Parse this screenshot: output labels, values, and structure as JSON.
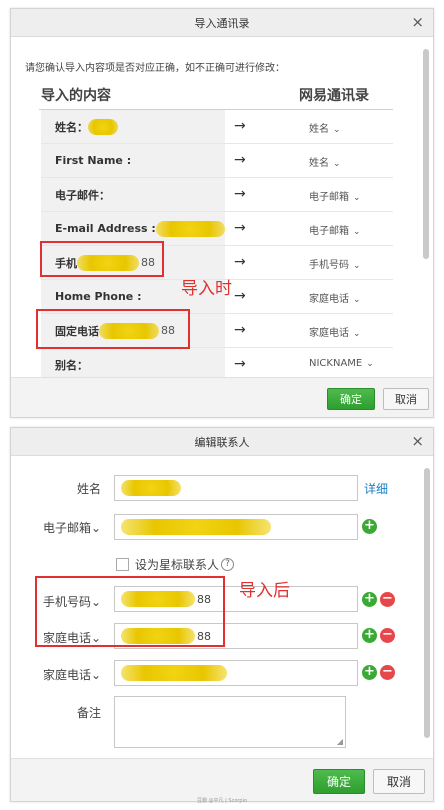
{
  "import_dialog": {
    "title": "导入通讯录",
    "close_glyph": "×",
    "intro": "请您确认导入内容项是否对应正确，如不正确可进行修改：",
    "col_source": "导入的内容",
    "col_target": "网易通讯录",
    "arrow_glyph": "→",
    "chevron_glyph": "⌄",
    "rows": [
      {
        "source": "姓名：",
        "value_suffix": "",
        "target": "姓名"
      },
      {
        "source": "First Name :",
        "value_suffix": "",
        "target": "姓名"
      },
      {
        "source": "电子邮件：",
        "value_suffix": "",
        "target": "电子邮箱"
      },
      {
        "source": "E-mail Address :",
        "value_suffix": "",
        "target": "电子邮箱"
      },
      {
        "source": "手机",
        "value_suffix": "88",
        "target": "手机号码"
      },
      {
        "source": "Home Phone :",
        "value_suffix": "",
        "target": "家庭电话"
      },
      {
        "source": "固定电话",
        "value_suffix": "88",
        "target": "家庭电话"
      },
      {
        "source": "别名：",
        "value_suffix": "",
        "target": "NICKNAME"
      }
    ],
    "annotation": "导入时",
    "ok_label": "确定",
    "cancel_label": "取消"
  },
  "edit_dialog": {
    "title": "编辑联系人",
    "close_glyph": "×",
    "name_label": "姓名",
    "detail_link": "详细",
    "email_label": "电子邮箱⌄",
    "star_label": "设为星标联系人",
    "help_glyph": "?",
    "mobile_label": "手机号码⌄",
    "mobile_suffix": "88",
    "home_label": "家庭电话⌄",
    "home_suffix": "88",
    "home2_label": "家庭电话⌄",
    "note_label": "备注",
    "plus_glyph": "+",
    "minus_glyph": "−",
    "resize_glyph": "◢",
    "annotation": "导入后",
    "ok_label": "确定",
    "cancel_label": "取消"
  },
  "watermark": "豆瓣 @平凡 | Scorpio",
  "colors": {
    "accent_green": "#3aaa35",
    "annotation_red": "#e03030",
    "link_blue": "#1a7fc1",
    "blur_yellow": "#e8c600"
  }
}
